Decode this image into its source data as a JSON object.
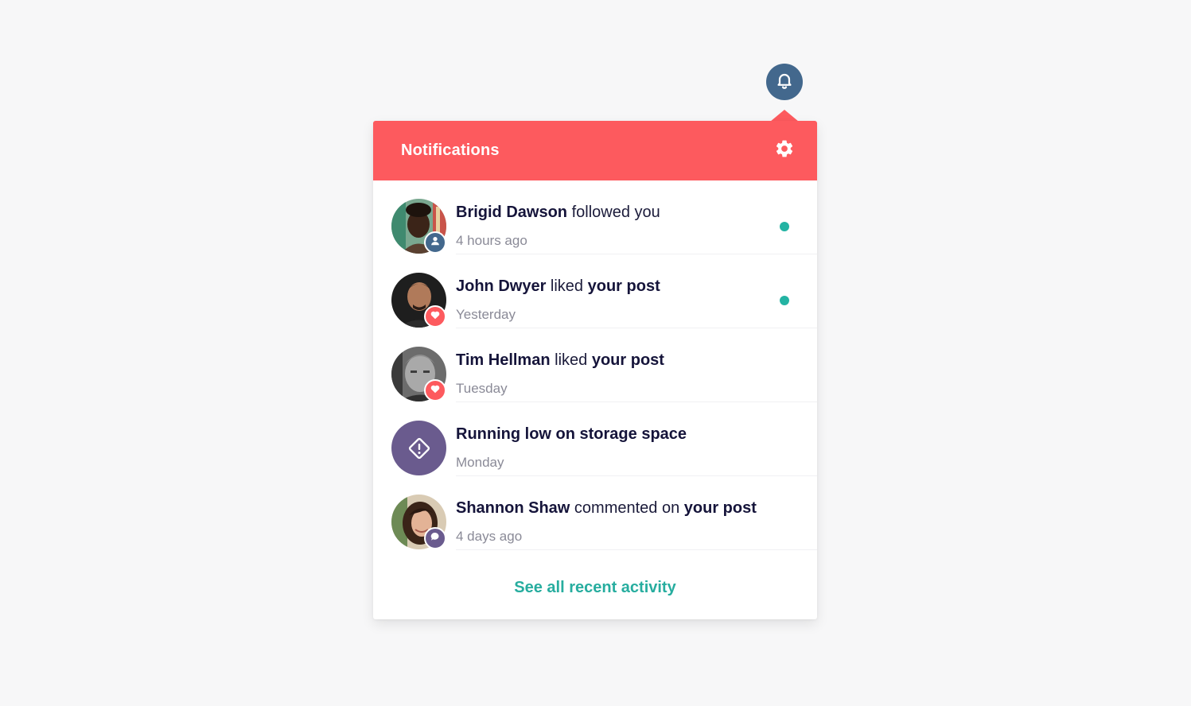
{
  "header": {
    "bell_icon": "bell-icon",
    "title": "Notifications",
    "settings_icon": "gear-icon"
  },
  "colors": {
    "header_bg": "#fd5a5e",
    "bell_bg": "#43688d",
    "unread_dot": "#23b3a3",
    "link": "#27ad9f",
    "follow_badge": "#43688d",
    "like_badge": "#fd5a5e",
    "comment_badge": "#6a5b8e",
    "alert_avatar": "#6a5b8e"
  },
  "notifications": [
    {
      "actor": "Brigid Dawson",
      "action": "followed you",
      "object": "",
      "time": "4 hours ago",
      "badge": "user-icon",
      "unread": true
    },
    {
      "actor": "John Dwyer",
      "action": "liked",
      "object": "your post",
      "time": "Yesterday",
      "badge": "heart-icon",
      "unread": true
    },
    {
      "actor": "Tim Hellman",
      "action": "liked",
      "object": "your post",
      "time": "Tuesday",
      "badge": "heart-icon",
      "unread": false
    },
    {
      "actor": "Running low on storage space",
      "action": "",
      "object": "",
      "time": "Monday",
      "badge": "warning-diamond-icon",
      "unread": false
    },
    {
      "actor": "Shannon Shaw",
      "action": "commented on",
      "object": "your post",
      "time": "4 days ago",
      "badge": "comment-icon",
      "unread": false
    }
  ],
  "footer": {
    "see_all_label": "See all recent activity"
  }
}
